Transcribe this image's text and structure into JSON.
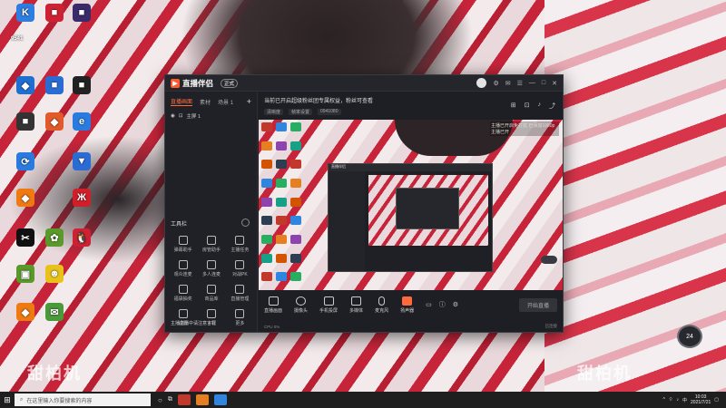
{
  "desktop": {
    "icons": [
      {
        "label": "",
        "color": "#2e7de0",
        "glyph": "K"
      },
      {
        "label": "",
        "color": "#cc2233",
        "glyph": "■"
      },
      {
        "label": "",
        "color": "#3a2a6a",
        "glyph": "■"
      },
      {
        "label": "",
        "color": "#1f6fd1",
        "glyph": "◆"
      },
      {
        "label": "",
        "color": "#2b6cd4",
        "glyph": "■"
      },
      {
        "label": "",
        "color": "#222",
        "glyph": "■"
      },
      {
        "label": "",
        "color": "#333",
        "glyph": "■"
      },
      {
        "label": "",
        "color": "#e35a2a",
        "glyph": "◆"
      },
      {
        "label": "",
        "color": "#2a7be0",
        "glyph": "e"
      },
      {
        "label": "",
        "color": "#2a7be0",
        "glyph": "⟳"
      },
      {
        "label": "",
        "color": "#2a6cd4",
        "glyph": "▼"
      },
      {
        "label": "",
        "color": "#f07a12",
        "glyph": "◆"
      },
      {
        "label": "",
        "color": "#d11f2a",
        "glyph": "Ж"
      },
      {
        "label": "",
        "color": "#111",
        "glyph": "✂"
      },
      {
        "label": "",
        "color": "#5a9a2a",
        "glyph": "✿"
      },
      {
        "label": "",
        "color": "#cc2233",
        "glyph": "🐧"
      },
      {
        "label": "",
        "color": "#5a9a2a",
        "glyph": "▣"
      },
      {
        "label": "",
        "color": "#e8c21a",
        "glyph": "☻"
      },
      {
        "label": "",
        "color": "#f07a12",
        "glyph": "◆"
      },
      {
        "label": "",
        "color": "#4a9a3a",
        "glyph": "✉"
      }
    ],
    "top_left_label": "9541",
    "watermark_text": "甜柏机"
  },
  "app": {
    "title": "直播伴侣",
    "version": "正式",
    "left_tabs": [
      "直播画面",
      "素材",
      "场景 1"
    ],
    "scene_label": "主屏 1",
    "tools_title": "工具栏",
    "tools": [
      "弹幕助手",
      "房管助手",
      "主播任务",
      "观众连麦",
      "多人连麦",
      "对战PK",
      "福袋抽奖",
      "商品库",
      "直播管理",
      "设置",
      "下载",
      "更多"
    ],
    "left_footer": "主播直播中请注意言行",
    "info_title": "当前已开启超级粉丝团专属权益，粉丝可查看",
    "info_sub": [
      "清晰度",
      "帧率设置",
      "0941080"
    ],
    "overlay_text": "主播已开启免打扰 已添加1080p 主播已开",
    "bottom_buttons": [
      "直播画面",
      "摄像头",
      "手机投屏",
      "多媒体",
      "麦克风",
      "扬声器"
    ],
    "start_live": "开始直播",
    "status_left": "CPU 0%",
    "status_right": "已连接"
  },
  "widget": {
    "speed_value": "24"
  },
  "taskbar": {
    "search_placeholder": "在这里输入你要搜索的内容",
    "time": "10:03",
    "date": "2021/7/21"
  }
}
